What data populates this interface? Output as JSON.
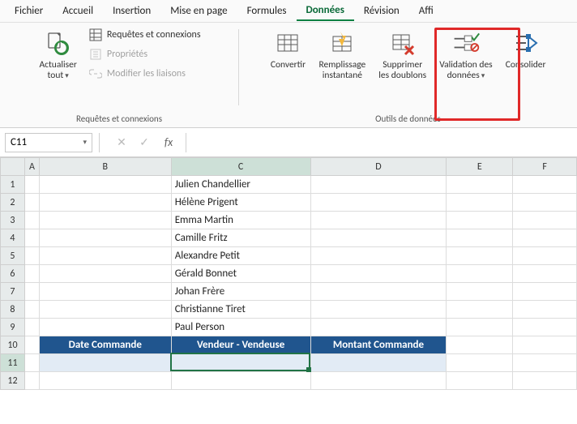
{
  "menu": {
    "tabs": [
      "Fichier",
      "Accueil",
      "Insertion",
      "Mise en page",
      "Formules",
      "Données",
      "Révision",
      "Affi"
    ],
    "active": "Données"
  },
  "ribbon": {
    "refresh": {
      "label": "Actualiser\ntout",
      "queries": "Requêtes et connexions",
      "props": "Propriétés",
      "links": "Modifier les liaisons",
      "group_label": "Requêtes et connexions"
    },
    "convert": {
      "label": "Convertir"
    },
    "flashfill": {
      "label": "Remplissage\ninstantané"
    },
    "dedup": {
      "label": "Supprimer\nles doublons"
    },
    "validation": {
      "label": "Validation des\ndonnées"
    },
    "consolidate": {
      "label": "Consolider"
    },
    "group2_label": "Outils de données"
  },
  "formulabar": {
    "namebox": "C11"
  },
  "sheet": {
    "columns": [
      "A",
      "B",
      "C",
      "D",
      "E",
      "F"
    ],
    "rows": [
      {
        "n": 1,
        "C": "Julien Chandellier"
      },
      {
        "n": 2,
        "C": "Hélène Prigent"
      },
      {
        "n": 3,
        "C": "Emma Martin"
      },
      {
        "n": 4,
        "C": "Camille Fritz"
      },
      {
        "n": 5,
        "C": "Alexandre Petit"
      },
      {
        "n": 6,
        "C": "Gérald Bonnet"
      },
      {
        "n": 7,
        "C": "Johan Frère"
      },
      {
        "n": 8,
        "C": "Christianne Tiret"
      },
      {
        "n": 9,
        "C": "Paul Person"
      },
      {
        "n": 10,
        "B": "Date Commande",
        "C": "Vendeur - Vendeuse",
        "D": "Montant Commande",
        "header": true
      },
      {
        "n": 11,
        "selected": true
      },
      {
        "n": 12
      }
    ],
    "selected_cell": "C11"
  }
}
